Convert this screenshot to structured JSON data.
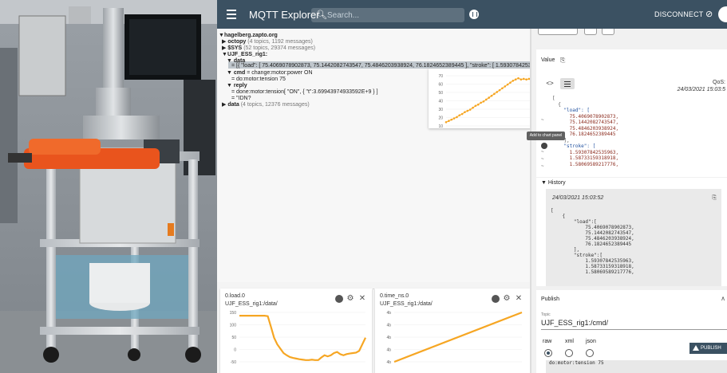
{
  "app": {
    "title": "MQTT Explorer",
    "search_placeholder": "Search...",
    "disconnect_label": "DISCONNECT"
  },
  "tree": {
    "root": "hagelberg.zapto.org",
    "topics": [
      {
        "label": "octopy",
        "meta": "(4 topics, 1192 messages)"
      },
      {
        "label": "$SYS",
        "meta": "(52 topics, 29374 messages)"
      }
    ],
    "rig": "UJF_ESS_rig1:",
    "data_label": "data",
    "data_value": "= [{ \"load\": [ 75.4069078902873, 75.1442082743547, 75.4846203938924, 76.1824652389445 ], \"stroke\": [ 1.59307842535...",
    "cmd_label": "cmd",
    "cmd_value": "= change:motor:power ON",
    "cmd_sub": "= do:motor:tension 75",
    "reply_label": "reply",
    "reply_value": "= done:motor:tension[ \"ON\", { \"t\":3.69943974933592E+9 } ]",
    "reply_sub": "= \"IDN?",
    "data2_label": "data",
    "data2_meta": "(4 topics, 12376 messages)"
  },
  "hover_chart": {
    "yticks": [
      "70",
      "60",
      "50",
      "40",
      "30",
      "20",
      "10"
    ]
  },
  "charts": [
    {
      "title": "0.load.0",
      "path": "UJF_ESS_rig1:/data/",
      "yticks": [
        "150",
        "100",
        "50",
        "0",
        "-50"
      ]
    },
    {
      "title": "0.time_ns.0",
      "path": "UJF_ESS_rig1:/data/",
      "yticks": [
        "4b",
        "4b",
        "4b",
        "4b",
        "4b"
      ]
    }
  ],
  "chart_data": [
    {
      "type": "line",
      "title": "0.load.0",
      "ylim": [
        -50,
        175
      ],
      "x": [
        0,
        1,
        2,
        3,
        4,
        5,
        6,
        7,
        8,
        9,
        10,
        11,
        12,
        13,
        14,
        15,
        16,
        17,
        18,
        19,
        20,
        21,
        22,
        23,
        24,
        25,
        26,
        27,
        28,
        29,
        30,
        31,
        32,
        33,
        34,
        35,
        36,
        37,
        38,
        39,
        40
      ],
      "values": [
        160,
        160,
        160,
        160,
        160,
        160,
        160,
        160,
        160,
        158,
        110,
        60,
        30,
        10,
        -10,
        -20,
        -28,
        -32,
        -35,
        -38,
        -40,
        -42,
        -42,
        -40,
        -42,
        -42,
        -30,
        -20,
        -25,
        -20,
        -10,
        -5,
        -15,
        -20,
        -15,
        -12,
        -10,
        -8,
        0,
        30,
        60
      ]
    },
    {
      "type": "line",
      "title": "0.time_ns.0",
      "x": [
        0,
        1
      ],
      "values": [
        0,
        1
      ]
    },
    {
      "type": "line",
      "ylim": [
        0,
        80
      ],
      "x": [
        0,
        1,
        2,
        3,
        4,
        5,
        6,
        7,
        8,
        9,
        10,
        11,
        12,
        13,
        14,
        15,
        16,
        17,
        18,
        19,
        20,
        21,
        22,
        23,
        24,
        25,
        26,
        27,
        28,
        29,
        30,
        31,
        32,
        33,
        34
      ],
      "values": [
        6,
        8,
        10,
        12,
        14,
        17,
        19,
        22,
        24,
        26,
        29,
        32,
        34,
        37,
        39,
        42,
        45,
        48,
        51,
        54,
        57,
        60,
        63,
        66,
        69,
        72,
        74,
        76,
        74,
        75,
        74,
        75,
        74,
        75,
        75
      ]
    }
  ],
  "value_panel": {
    "title": "Value",
    "qos": "QoS:",
    "timestamp": "24/03/2021 15:03:5",
    "code_lines": [
      "[",
      "  {",
      "    \"load\": [",
      "      75.4069078902873,",
      "      75.1442082743547,",
      "      75.4846203938924,",
      "      76.1824652389445",
      "    ],",
      "    \"stroke\": [",
      "      1.59307842535963,",
      "      1.58733159318918,",
      "      1.58069589217776,"
    ],
    "tooltip": "Add to chart panel"
  },
  "history": {
    "title": "History",
    "timestamp": "24/03/2021 15:03:52",
    "code": "[\n    {\n        \"load\":[\n            75.4069078902873,\n            75.1442082743547,\n            75.4846203938924,\n            76.1824652389445\n        ],\n        \"stroke\":[\n            1.59307842535963,\n            1.58733159318918,\n            1.58069589217776,"
  },
  "publish": {
    "title": "Publish",
    "topic_label": "Topic",
    "topic": "UJF_ESS_rig1:/cmd/",
    "formats": [
      "raw",
      "xml",
      "json"
    ],
    "selected_format": "raw",
    "button": "PUBLISH",
    "payload": "do:motor:tension 75"
  },
  "colors": {
    "appbar": "#3b5162",
    "chart_line": "#f6a623"
  }
}
